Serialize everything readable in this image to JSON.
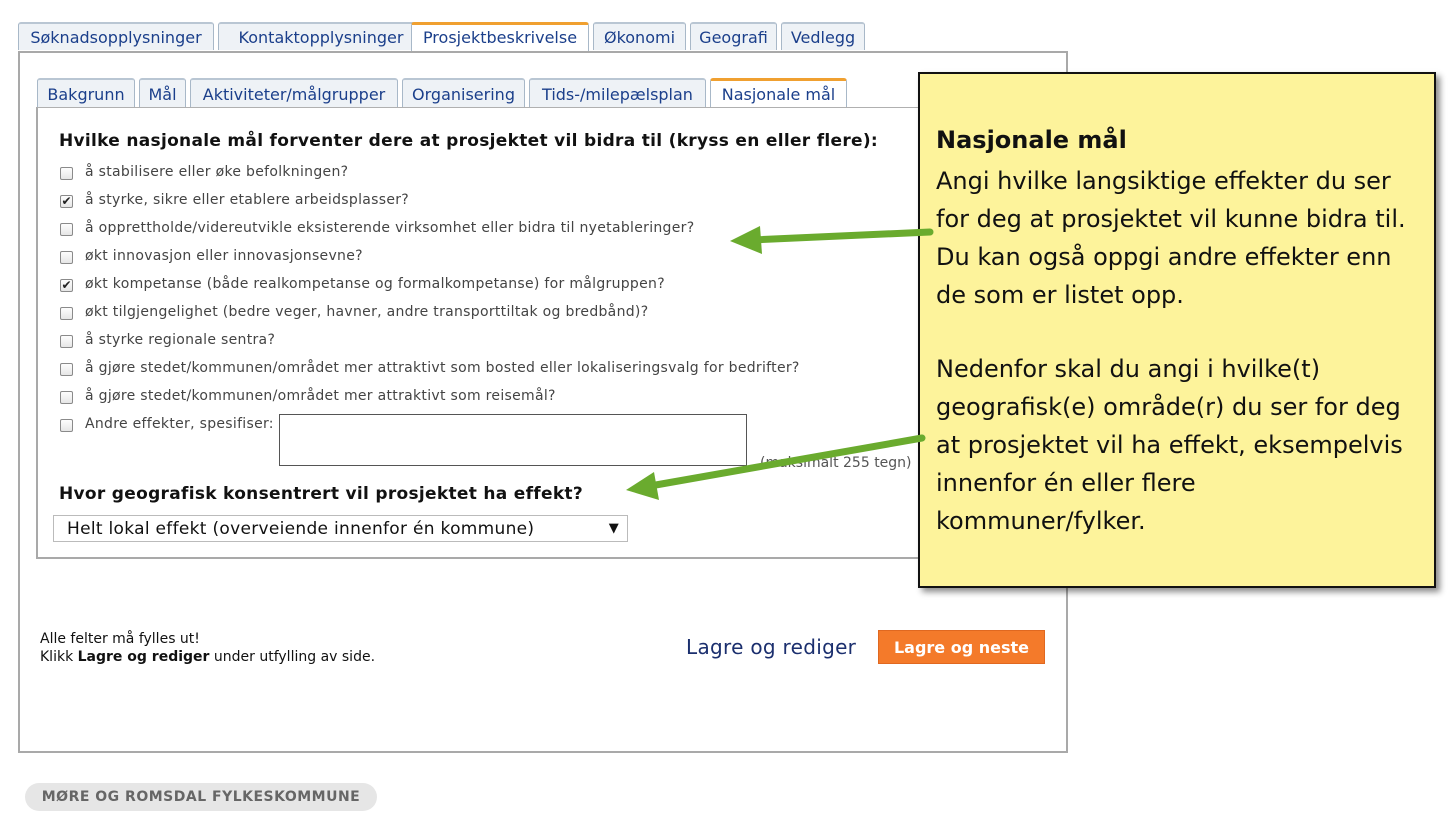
{
  "top_tabs": [
    {
      "label": "Søknadsopplysninger",
      "active": false
    },
    {
      "label": "Kontaktopplysninger",
      "active": false
    },
    {
      "label": "Prosjektbeskrivelse",
      "active": true
    },
    {
      "label": "Økonomi",
      "active": false
    },
    {
      "label": "Geografi",
      "active": false
    },
    {
      "label": "Vedlegg",
      "active": false
    }
  ],
  "sub_tabs": [
    {
      "label": "Bakgrunn",
      "active": false
    },
    {
      "label": "Mål",
      "active": false
    },
    {
      "label": "Aktiviteter/målgrupper",
      "active": false
    },
    {
      "label": "Organisering",
      "active": false
    },
    {
      "label": "Tids-/milepælsplan",
      "active": false
    },
    {
      "label": "Nasjonale mål",
      "active": true
    }
  ],
  "form": {
    "question1": "Hvilke nasjonale mål forventer dere at prosjektet vil bidra til (kryss en eller flere):",
    "options": [
      {
        "label": "å stabilisere eller øke befolkningen?",
        "checked": false
      },
      {
        "label": "å styrke, sikre eller etablere arbeidsplasser?",
        "checked": true
      },
      {
        "label": "å opprettholde/videreutvikle eksisterende virksomhet eller bidra til nyetableringer?",
        "checked": false
      },
      {
        "label": "økt innovasjon eller innovasjonsevne?",
        "checked": false
      },
      {
        "label": "økt kompetanse (både realkompetanse og formalkompetanse) for målgruppen?",
        "checked": true
      },
      {
        "label": "økt tilgjengelighet (bedre veger, havner, andre transporttiltak og bredbånd)?",
        "checked": false
      },
      {
        "label": "å styrke regionale sentra?",
        "checked": false
      },
      {
        "label": "å gjøre stedet/kommunen/området mer attraktivt som bosted eller lokaliseringsvalg for bedrifter?",
        "checked": false
      },
      {
        "label": "å gjøre stedet/kommunen/området mer attraktivt som reisemål?",
        "checked": false
      }
    ],
    "other_label": "Andre effekter, spesifiser:",
    "other_checked": false,
    "other_value": "",
    "char_limit_note": "(maksimalt 255 tegn)",
    "question2": "Hvor geografisk konsentrert vil prosjektet ha effekt?",
    "select_value": "Helt lokal effekt (overveiende innenfor én kommune)",
    "caret": "▼"
  },
  "callout": {
    "title": "Nasjonale mål",
    "text1": "Angi hvilke langsiktige effekter du ser\nfor deg at prosjektet vil kunne bidra til.\nDu kan også oppgi andre effekter enn\nde som er listet opp.",
    "text2": "Nedenfor skal du angi i hvilke(t)\ngeografisk(e) område(r) du ser for deg\nat prosjektet vil ha effekt, eksempelvis\ninnenfor én eller flere\nkommuner/fylker.",
    "bg_color": "#fdf39b",
    "arrow_color": "#6aab2e"
  },
  "footer": {
    "line1": "Alle felter må fylles ut!",
    "line2_prefix": "Klikk ",
    "line2_bold": "Lagre og rediger",
    "line2_suffix": " under utfylling av side.",
    "save_edit": "Lagre og rediger",
    "save_next": "Lagre og neste",
    "save_next_color": "#f47a2a"
  },
  "brand": "MØRE OG ROMSDAL FYLKESKOMMUNE"
}
